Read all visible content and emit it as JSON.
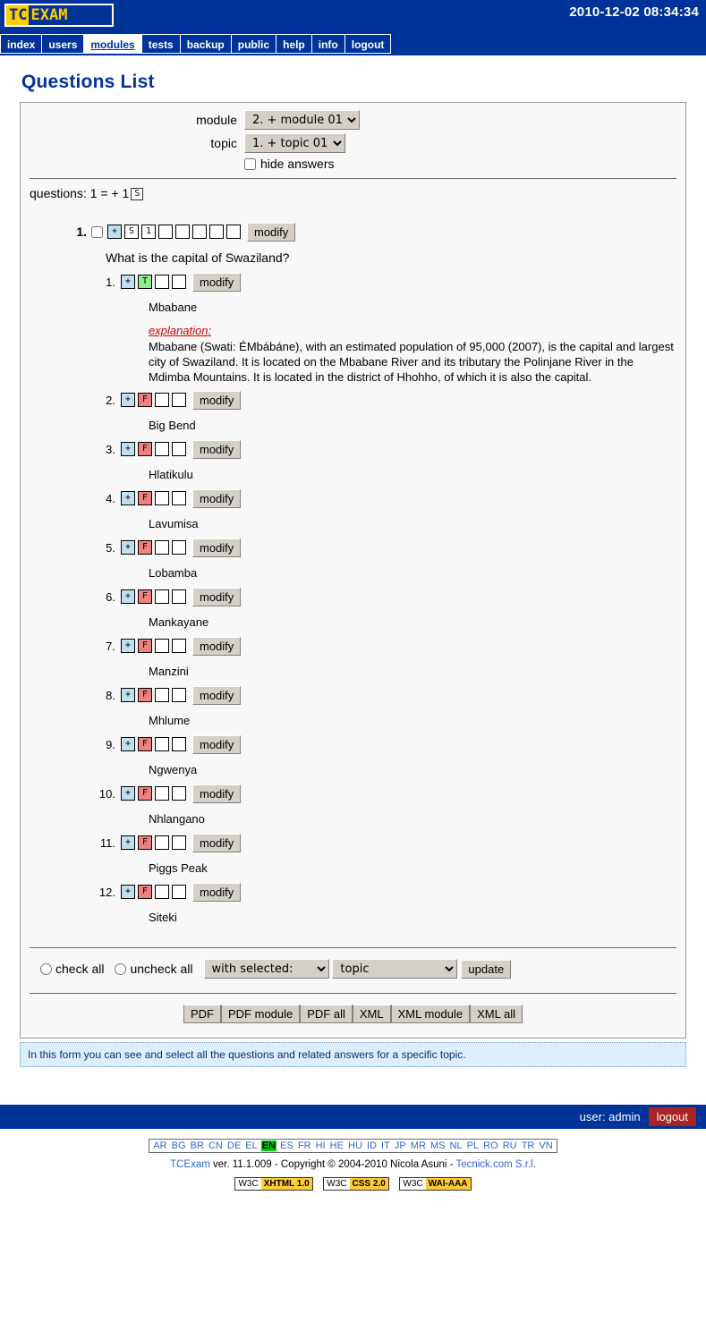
{
  "header": {
    "logo_tc": "TC",
    "logo_exam": "EXAM",
    "datetime": "2010-12-02 08:34:34"
  },
  "menu": {
    "items": [
      {
        "label": "index",
        "active": false
      },
      {
        "label": "users",
        "active": false
      },
      {
        "label": "modules",
        "active": true
      },
      {
        "label": "tests",
        "active": false
      },
      {
        "label": "backup",
        "active": false
      },
      {
        "label": "public",
        "active": false
      },
      {
        "label": "help",
        "active": false
      },
      {
        "label": "info",
        "active": false
      },
      {
        "label": "logout",
        "active": false
      }
    ]
  },
  "page": {
    "title": "Questions List"
  },
  "filters": {
    "module_label": "module",
    "module_value": "2. + module 01",
    "topic_label": "topic",
    "topic_value": "1. + topic 01",
    "hide_answers_label": "hide answers",
    "hide_answers_checked": false
  },
  "summary": {
    "text": "questions: 1 = + 1",
    "badge": "S"
  },
  "question": {
    "number": "1.",
    "tiles": [
      "+",
      "S",
      "1",
      "",
      "",
      "",
      "",
      ""
    ],
    "modify_label": "modify",
    "text": "What is the capital of Swaziland?",
    "answers": [
      {
        "number": "1.",
        "flag": "T",
        "label": "Mbabane",
        "explanation_label": "explanation:",
        "explanation": "Mbabane (Swati: ÉMbábáne), with an estimated population of 95,000 (2007), is the capital and largest city of Swaziland. It is located on the Mbabane River and its tributary the Polinjane River in the Mdimba Mountains. It is located in the district of Hhohho, of which it is also the capital.",
        "modify_label": "modify"
      },
      {
        "number": "2.",
        "flag": "F",
        "label": "Big Bend",
        "modify_label": "modify"
      },
      {
        "number": "3.",
        "flag": "F",
        "label": "Hlatikulu",
        "modify_label": "modify"
      },
      {
        "number": "4.",
        "flag": "F",
        "label": "Lavumisa",
        "modify_label": "modify"
      },
      {
        "number": "5.",
        "flag": "F",
        "label": "Lobamba",
        "modify_label": "modify"
      },
      {
        "number": "6.",
        "flag": "F",
        "label": "Mankayane",
        "modify_label": "modify"
      },
      {
        "number": "7.",
        "flag": "F",
        "label": "Manzini",
        "modify_label": "modify"
      },
      {
        "number": "8.",
        "flag": "F",
        "label": "Mhlume",
        "modify_label": "modify"
      },
      {
        "number": "9.",
        "flag": "F",
        "label": "Ngwenya",
        "modify_label": "modify"
      },
      {
        "number": "10.",
        "flag": "F",
        "label": "Nhlangano",
        "modify_label": "modify"
      },
      {
        "number": "11.",
        "flag": "F",
        "label": "Piggs Peak",
        "modify_label": "modify"
      },
      {
        "number": "12.",
        "flag": "F",
        "label": "Siteki",
        "modify_label": "modify"
      }
    ]
  },
  "bottom": {
    "check_all": "check all",
    "uncheck_all": "uncheck all",
    "with_selected": "with selected:",
    "target": "topic",
    "update": "update",
    "export_buttons": [
      "PDF",
      "PDF module",
      "PDF all",
      "XML",
      "XML module",
      "XML all"
    ]
  },
  "help": {
    "text": "In this form you can see and select all the questions and related answers for a specific topic."
  },
  "footer": {
    "user": "user: admin",
    "logout": "logout",
    "languages": [
      "AR",
      "BG",
      "BR",
      "CN",
      "DE",
      "EL",
      "EN",
      "ES",
      "FR",
      "HI",
      "HE",
      "HU",
      "ID",
      "IT",
      "JP",
      "MR",
      "MS",
      "NL",
      "PL",
      "RO",
      "RU",
      "TR",
      "VN"
    ],
    "current_language": "EN",
    "copyright_app": "TCExam",
    "copyright_text": " ver. 11.1.009 - Copyright © 2004-2010 Nicola Asuni - ",
    "copyright_link": "Tecnick.com S.r.l.",
    "badges": [
      {
        "left": "W3C",
        "right": "XHTML 1.0"
      },
      {
        "left": "W3C",
        "right": "CSS 2.0"
      },
      {
        "left": "W3C",
        "right": "WAI-AAA"
      }
    ]
  },
  "colors": {
    "brand_blue": "#003399",
    "logo_yellow": "#FFCC00",
    "true_green": "#90ee90",
    "false_red": "#f08080",
    "plus_blue": "#bfe0ee",
    "logout_red": "#aa2222"
  }
}
